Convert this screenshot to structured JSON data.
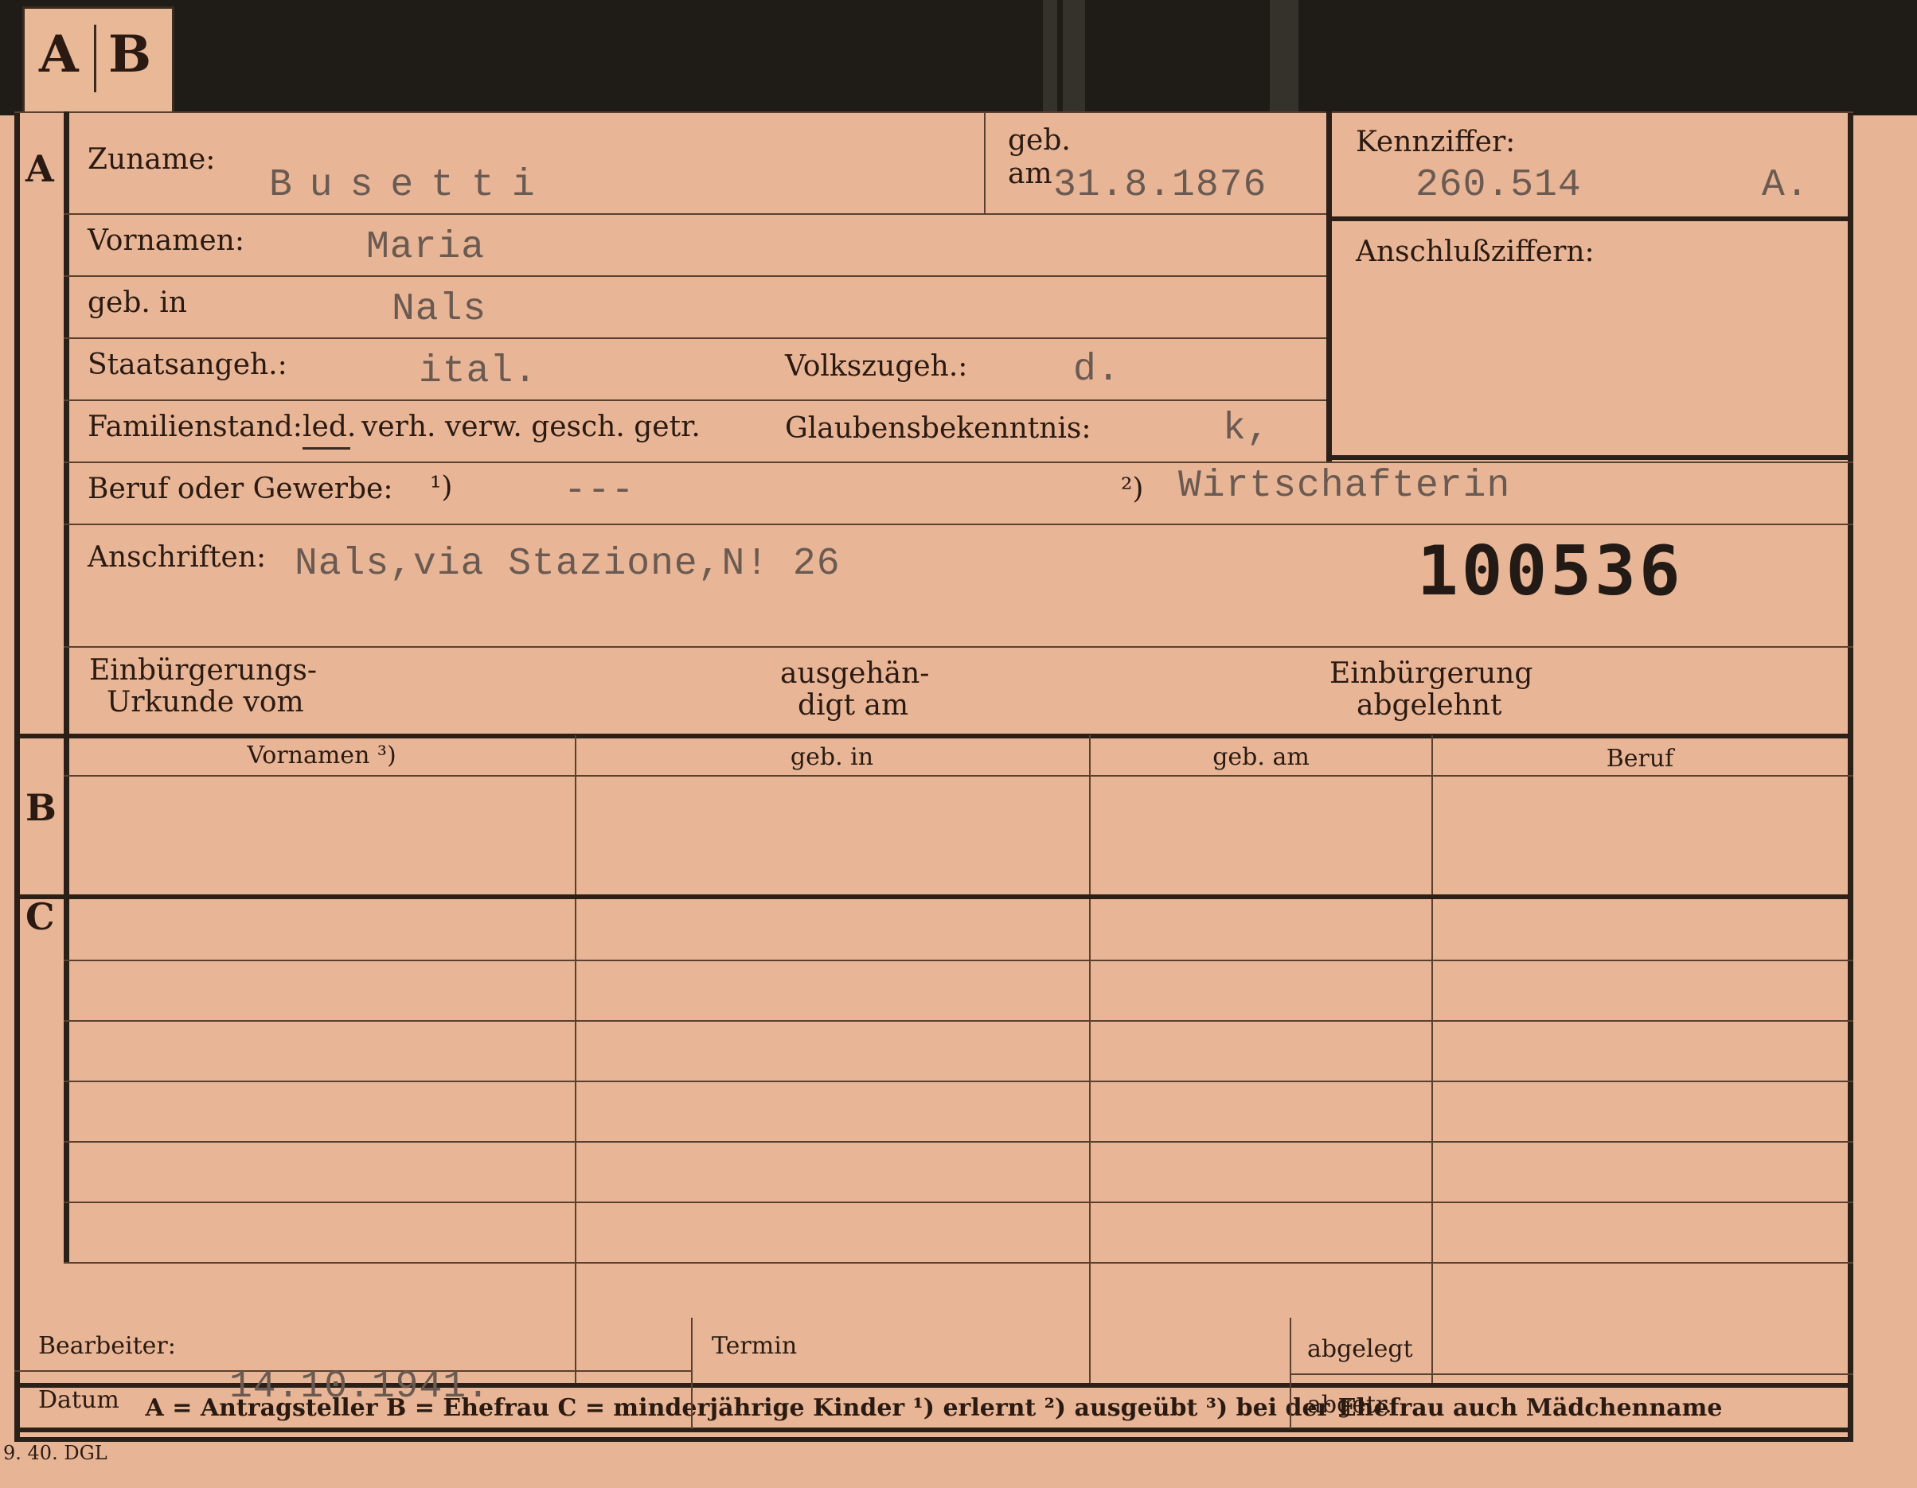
{
  "tab": {
    "letter_a": "A",
    "letter_b": "B"
  },
  "sections": {
    "a": "A",
    "b": "B",
    "c": "C"
  },
  "labels": {
    "zuname": "Zuname:",
    "geb_am_1": "geb.",
    "geb_am_2": "am",
    "kennziffer": "Kennziffer:",
    "anschlussziffern": "Anschlußziffern:",
    "vornamen": "Vornamen:",
    "geb_in": "geb. in",
    "staatsangeh": "Staatsangeh.:",
    "volkszugeh": "Volkszugeh.:",
    "familienstand": "Familienstand:",
    "familienstand_ledig": "led.",
    "familienstand_rest": "verh. verw. gesch. getr.",
    "glaubensbekenntnis": "Glaubensbekenntnis:",
    "beruf": "Beruf oder Gewerbe:",
    "beruf_note1": "¹)",
    "beruf_note2": "²)",
    "anschriften": "Anschriften:",
    "einbuergerung_1": "Einbürgerungs-",
    "einbuergerung_2": "Urkunde vom",
    "ausgehaendigt_1": "ausgehän-",
    "ausgehaendigt_2": "digt am",
    "abgelehnt_1": "Einbürgerung",
    "abgelehnt_2": "abgelehnt"
  },
  "values": {
    "zuname": "Busetti",
    "geb_am": "31.8.1876",
    "kennziffer": "260.514",
    "kennziffer_suffix": "A.",
    "vornamen": "Maria",
    "geb_in": "Nals",
    "staatsangeh": "ital.",
    "volkszugeh": "d.",
    "glaubensbekenntnis": "k,",
    "beruf_erlernt": "---",
    "beruf_ausgeuebt": "Wirtschafterin",
    "anschrift": "Nals,via Stazione,N! 26",
    "stamp_number": "100536"
  },
  "table_headers": [
    "Vornamen ³)",
    "geb. in",
    "geb. am",
    "Beruf"
  ],
  "legend": "A = Antragsteller   B = Ehefrau   C = minderjährige Kinder   ¹) erlernt   ²) ausgeübt   ³) bei der Ehefrau auch Mädchenname",
  "footer": {
    "bearbeiter": "Bearbeiter:",
    "datum": "Datum",
    "datum_value": "14.10.1941.",
    "termin": "Termin",
    "abgelegt": "abgelegt",
    "abgetr": "abgetr."
  },
  "print_code": "9. 40. DGL"
}
